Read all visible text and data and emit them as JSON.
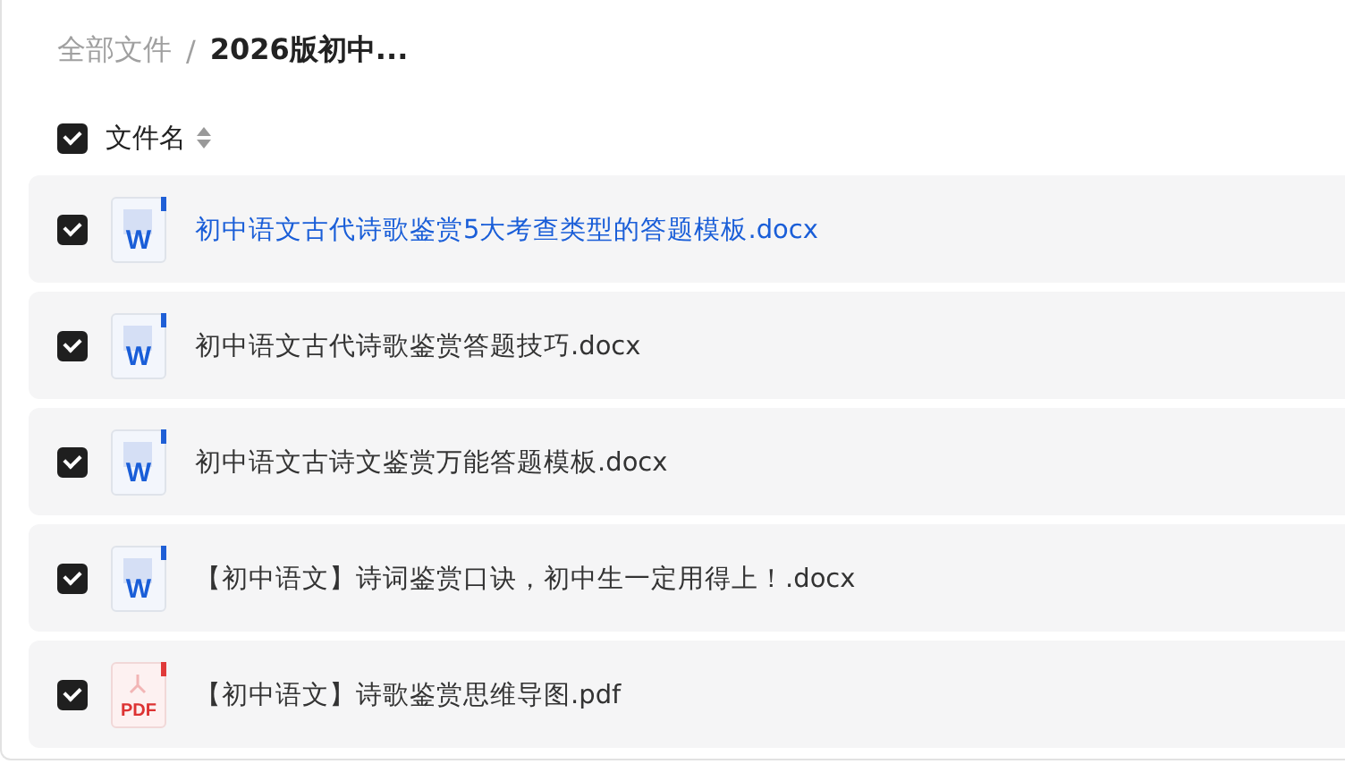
{
  "breadcrumb": [
    {
      "label": "全部文件",
      "current": false
    },
    {
      "label": "2026版初中...",
      "current": true
    }
  ],
  "breadcrumb_separator": "/",
  "header": {
    "checked": true,
    "column_label": "文件名"
  },
  "files": [
    {
      "kind": "word",
      "badge": "W",
      "name": "初中语文古代诗歌鉴赏5大考查类型的答题模板.docx",
      "checked": true,
      "highlighted": true
    },
    {
      "kind": "word",
      "badge": "W",
      "name": "初中语文古代诗歌鉴赏答题技巧.docx",
      "checked": true,
      "highlighted": false
    },
    {
      "kind": "word",
      "badge": "W",
      "name": "初中语文古诗文鉴赏万能答题模板.docx",
      "checked": true,
      "highlighted": false
    },
    {
      "kind": "word",
      "badge": "W",
      "name": "【初中语文】诗词鉴赏口诀，初中生一定用得上！.docx",
      "checked": true,
      "highlighted": false
    },
    {
      "kind": "pdf",
      "badge": "PDF",
      "name": "【初中语文】诗歌鉴赏思维导图.pdf",
      "checked": true,
      "highlighted": false
    }
  ]
}
